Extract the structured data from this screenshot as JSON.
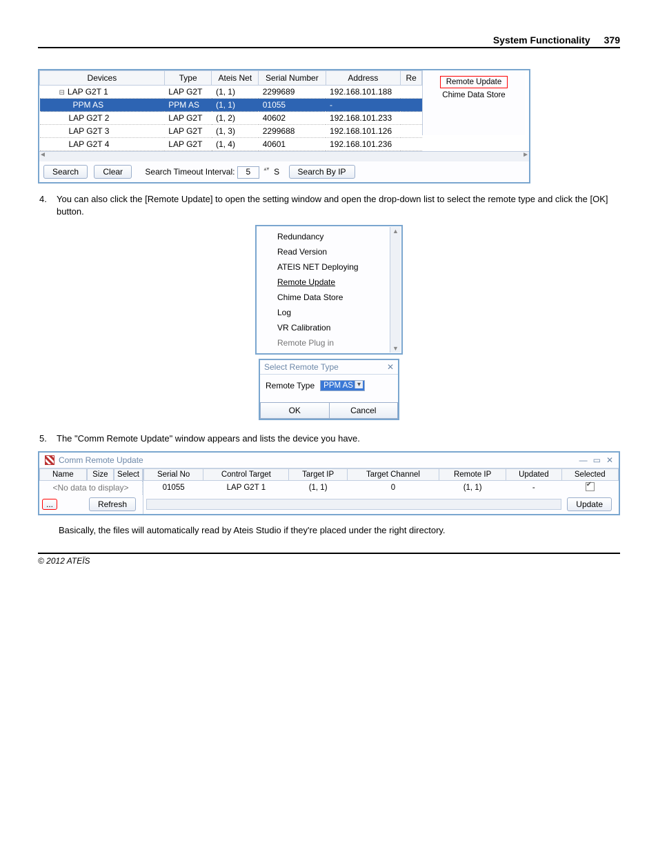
{
  "header": {
    "title": "System Functionality",
    "page": "379"
  },
  "footer": {
    "copyright": "© 2012 ATEÏS"
  },
  "devtable": {
    "headers": [
      "Devices",
      "Type",
      "Ateis Net",
      "Serial Number",
      "Address",
      "Re"
    ],
    "rows": [
      {
        "dev": "LAP G2T 1",
        "type": "LAP G2T",
        "net": "(1, 1)",
        "sn": "2299689",
        "addr": "192.168.101.188",
        "tree": "minus",
        "indent": 1
      },
      {
        "dev": "PPM AS",
        "type": "PPM AS",
        "net": "(1, 1)",
        "sn": "01055",
        "addr": "-",
        "indent": 2,
        "selected": true
      },
      {
        "dev": "LAP G2T 2",
        "type": "LAP G2T",
        "net": "(1, 2)",
        "sn": "40602",
        "addr": "192.168.101.233",
        "indent": 1
      },
      {
        "dev": "LAP G2T 3",
        "type": "LAP G2T",
        "net": "(1, 3)",
        "sn": "2299688",
        "addr": "192.168.101.126",
        "indent": 1
      },
      {
        "dev": "LAP G2T 4",
        "type": "LAP G2T",
        "net": "(1, 4)",
        "sn": "40601",
        "addr": "192.168.101.236",
        "indent": 1
      }
    ],
    "side": {
      "remote_update": "Remote Update",
      "chime": "Chime Data Store"
    },
    "footer": {
      "search": "Search",
      "clear": "Clear",
      "interval_label": "Search Timeout Interval:",
      "interval_value": "5",
      "interval_unit": "S",
      "bip": "Search By IP"
    }
  },
  "step4": {
    "num": "4.",
    "text": "You can also click the [Remote Update] to open the setting window and open the drop-down list to select the remote type and click the [OK] button."
  },
  "menu": {
    "items": [
      "Redundancy",
      "Read Version",
      "ATEIS NET Deploying",
      "Remote Update",
      "Chime Data Store",
      "Log",
      "VR Calibration",
      "Remote Plug in"
    ],
    "underline_index": 3
  },
  "dialog": {
    "title": "Select Remote Type",
    "label": "Remote Type",
    "value": "PPM AS",
    "ok": "OK",
    "cancel": "Cancel"
  },
  "step5": {
    "num": "5.",
    "text": "The \"Comm Remote Update\" window appears and lists the device you have."
  },
  "comm": {
    "title": "Comm Remote Update",
    "left_headers": [
      "Name",
      "Size",
      "Select"
    ],
    "left_empty": "<No data to display>",
    "dots": "...",
    "refresh": "Refresh",
    "right_headers": [
      "Serial No",
      "Control Target",
      "Target IP",
      "Target Channel",
      "Remote IP",
      "Updated",
      "Selected"
    ],
    "right_row": {
      "sn": "01055",
      "ct": "LAP G2T 1",
      "tip": "(1, 1)",
      "tch": "0",
      "rip": "(1, 1)",
      "upd": "-",
      "sel": true
    },
    "update": "Update"
  },
  "closing": "Basically, the files will automatically read by Ateis Studio if they're placed under the right directory."
}
